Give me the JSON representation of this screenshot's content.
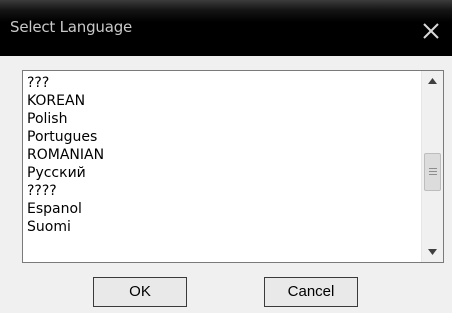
{
  "window": {
    "title": "Select Language",
    "close_icon": "close-icon"
  },
  "language_list": {
    "items": [
      "???",
      "KOREAN",
      "Polish",
      "Portugues",
      "ROMANIAN",
      "Русский",
      "????",
      "Espanol",
      "Suomi"
    ],
    "scroll_position": 0.5
  },
  "buttons": {
    "ok_label": "OK",
    "cancel_label": "Cancel"
  },
  "colors": {
    "titlebar": "#000000",
    "title_text": "#c8c8c8",
    "dialog_bg": "#f0f0f0",
    "list_bg": "#ffffff"
  }
}
